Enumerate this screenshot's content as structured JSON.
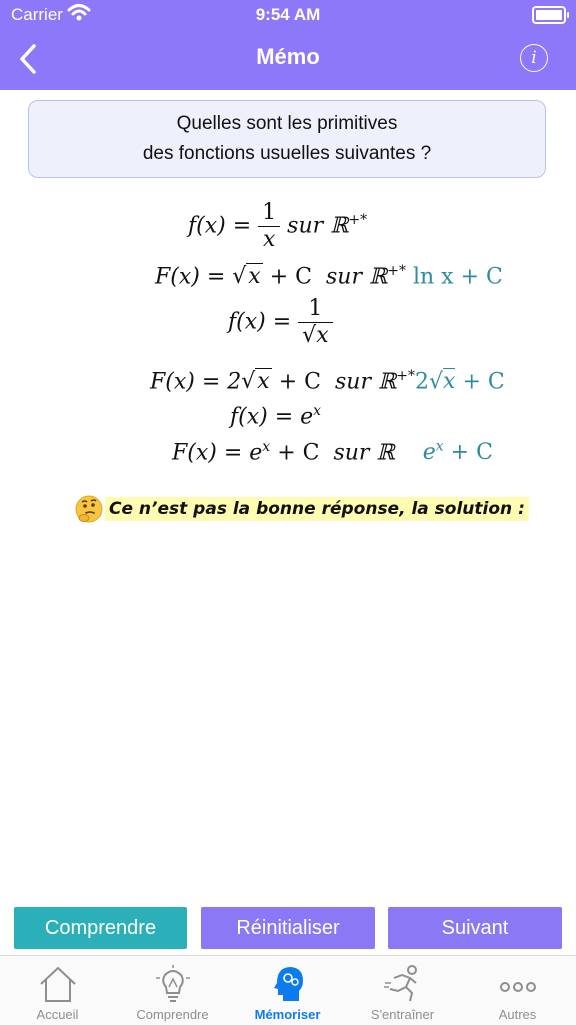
{
  "status_bar": {
    "carrier": "Carrier",
    "time": "9:54 AM"
  },
  "nav": {
    "title": "Mémo",
    "info_glyph": "i"
  },
  "question": {
    "line1": "Quelles sont les primitives",
    "line2": "des fonctions usuelles suivantes ?"
  },
  "math": {
    "row1": {
      "lhs": "f(x) =",
      "num": "1",
      "den": "x",
      "domain": "sur ℝ",
      "sup": "+*"
    },
    "row2": {
      "lhs": "F(x) =",
      "root": "x",
      "rest": "+ C",
      "domain": "sur ℝ",
      "sup": "+*",
      "answer": "ln x + C"
    },
    "row3": {
      "lhs": "f(x) =",
      "num": "1",
      "den_root": "x"
    },
    "row4": {
      "lhs": "F(x) = 2",
      "root": "x",
      "rest": "+ C",
      "domain": "sur ℝ",
      "sup": "+*",
      "answer_prefix": "2",
      "answer_root": "x",
      "answer_rest": "+ C"
    },
    "row5": {
      "lhs": "f(x) = e",
      "sup": "x"
    },
    "row6": {
      "lhs": "F(x) = e",
      "sup": "x",
      "rest": "+ C",
      "domain": "sur ℝ",
      "answer_base": "e",
      "answer_sup": "x",
      "answer_rest": "+ C"
    }
  },
  "feedback": {
    "message": "Ce n’est pas la bonne réponse, la solution :",
    "emoji": "thinking-face-icon"
  },
  "buttons": {
    "comprendre": "Comprendre",
    "reinitialiser": "Réinitialiser",
    "suivant": "Suivant"
  },
  "tabs": [
    {
      "label": "Accueil",
      "icon": "home-icon",
      "active": false
    },
    {
      "label": "Comprendre",
      "icon": "lightbulb-icon",
      "active": false
    },
    {
      "label": "Mémoriser",
      "icon": "brain-head-icon",
      "active": true
    },
    {
      "label": "S'entraîner",
      "icon": "runner-icon",
      "active": false
    },
    {
      "label": "Autres",
      "icon": "more-dots-icon",
      "active": false
    }
  ],
  "colors": {
    "header": "#8c78f8",
    "teal_button": "#2bb0b9",
    "purple_button": "#8a78f5",
    "active_tab": "#0d7bf0",
    "answer": "#2e8b9f",
    "highlight": "#fffbb0"
  }
}
